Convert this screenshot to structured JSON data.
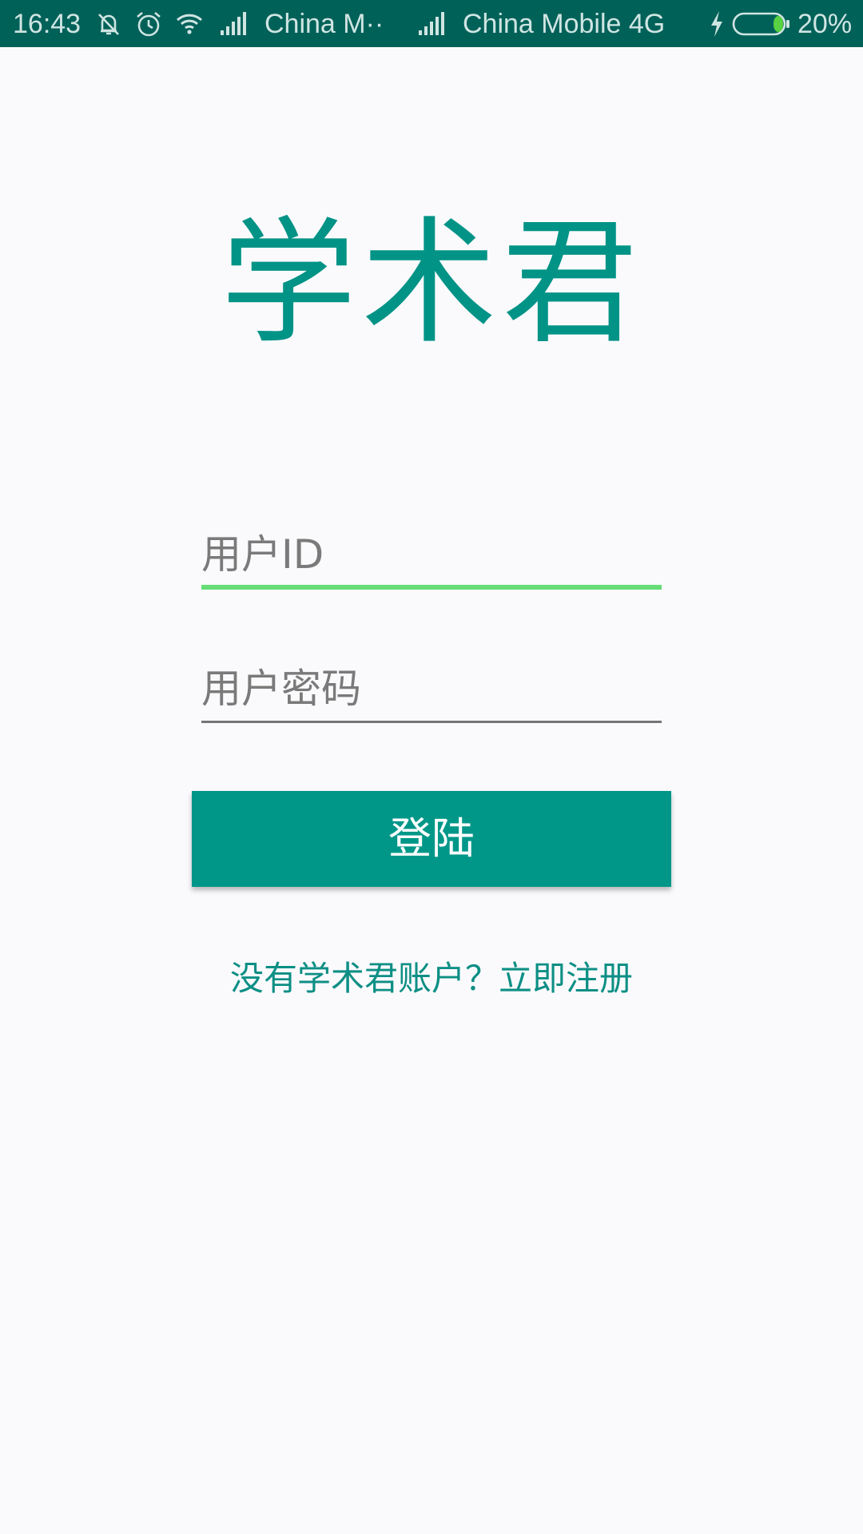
{
  "status_bar": {
    "time": "16:43",
    "carrier1": "China M··",
    "carrier2": "China Mobile 4G",
    "battery_percent": "20%",
    "battery_level": 0.2,
    "icons": [
      "mute-icon",
      "alarm-icon",
      "wifi-icon",
      "signal-icon",
      "signal-icon",
      "charging-icon",
      "battery-icon"
    ]
  },
  "app": {
    "title": "学术君"
  },
  "login_form": {
    "user_id_placeholder": "用户ID",
    "password_placeholder": "用户密码",
    "login_button": "登陆",
    "register_link": "没有学术君账户？立即注册"
  },
  "colors": {
    "status_bar_bg": "#006159",
    "accent": "#009788",
    "focused_underline": "#66dd77",
    "link": "#0d8f85"
  }
}
